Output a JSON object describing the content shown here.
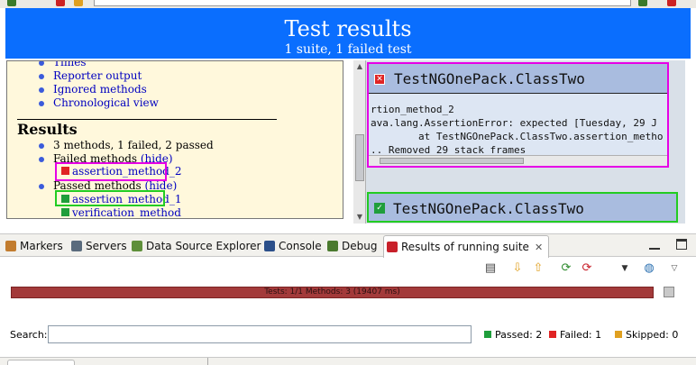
{
  "report": {
    "title": "Test results",
    "subtitle": "1 suite, 1 failed test"
  },
  "navigator": {
    "top_links": [
      "Times",
      "Reporter output",
      "Ignored methods",
      "Chronological view"
    ],
    "results_heading": "Results",
    "summary": "3 methods, 1 failed, 2 passed",
    "failed_label": "Failed methods",
    "failed_toggle": "(hide)",
    "failed_methods": [
      "assertion_method_2"
    ],
    "passed_label": "Passed methods",
    "passed_toggle": "(hide)",
    "passed_methods": [
      "assertion_method_1",
      "verification_method"
    ]
  },
  "cards": {
    "failed_class": "TestNGOnePack.ClassTwo",
    "failed_lines": [
      "rtion_method_2",
      "ava.lang.AssertionError: expected [Tuesday, 29 J",
      "        at TestNGOnePack.ClassTwo.assertion_metho",
      ".. Removed 29 stack frames"
    ],
    "passed_class": "TestNGOnePack.ClassTwo"
  },
  "tabs": [
    {
      "label": "Markers",
      "icon": "markers-icon",
      "color": "#c27c2e"
    },
    {
      "label": "Servers",
      "icon": "servers-icon",
      "color": "#5a6b7d"
    },
    {
      "label": "Data Source Explorer",
      "icon": "data-source-icon",
      "color": "#5e8f3a"
    },
    {
      "label": "Console",
      "icon": "console-icon",
      "color": "#2b4f8a"
    },
    {
      "label": "Debug",
      "icon": "debug-icon",
      "color": "#4a7a2e"
    },
    {
      "label": "Results of running suite",
      "icon": "testng-icon",
      "color": "#c8202a",
      "active": true
    }
  ],
  "progress": {
    "text": "Tests: 1/1  Methods: 3 (19407 ms)",
    "color": "#a33a3a"
  },
  "search": {
    "label": "Search:",
    "value": "",
    "placeholder": ""
  },
  "stats": {
    "passed": "Passed: 2",
    "failed": "Failed: 1",
    "skipped": "Skipped: 0",
    "passed_color": "#1f9e3b",
    "failed_color": "#e02424",
    "skipped_color": "#e0a020"
  }
}
